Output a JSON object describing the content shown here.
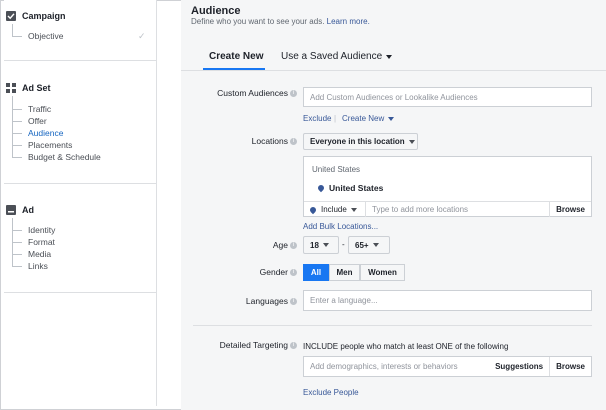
{
  "sidebar": {
    "campaign": {
      "title": "Campaign",
      "items": [
        "Objective"
      ],
      "done_mark": "✓"
    },
    "adset": {
      "title": "Ad Set",
      "items": [
        "Traffic",
        "Offer",
        "Audience",
        "Placements",
        "Budget & Schedule"
      ],
      "active": "Audience"
    },
    "ad": {
      "title": "Ad",
      "items": [
        "Identity",
        "Format",
        "Media",
        "Links"
      ]
    }
  },
  "main": {
    "title": "Audience",
    "subtitle": "Define who you want to see your ads.",
    "learn_more": "Learn more.",
    "tabs": [
      "Create New",
      "Use a Saved Audience"
    ],
    "custom_audiences": {
      "label": "Custom Audiences",
      "placeholder": "Add Custom Audiences or Lookalike Audiences",
      "exclude": "Exclude",
      "create_new": "Create New"
    },
    "locations": {
      "label": "Locations",
      "scope": "Everyone in this location",
      "country_header": "United States",
      "selected": "United States",
      "include": "Include",
      "type_placeholder": "Type to add more locations",
      "browse": "Browse",
      "bulk": "Add Bulk Locations..."
    },
    "age": {
      "label": "Age",
      "min": "18",
      "dash": "-",
      "max": "65+"
    },
    "gender": {
      "label": "Gender",
      "options": [
        "All",
        "Men",
        "Women"
      ],
      "selected": "All"
    },
    "languages": {
      "label": "Languages",
      "placeholder": "Enter a language..."
    },
    "detailed_targeting": {
      "label": "Detailed Targeting",
      "include_text": "INCLUDE people who match at least ONE of the following",
      "placeholder": "Add demographics, interests or behaviors",
      "suggestions": "Suggestions",
      "browse": "Browse",
      "exclude_people": "Exclude People"
    }
  },
  "colors": {
    "accent": "#1877f2",
    "link": "#385898",
    "panel_bg": "#f5f6f7"
  }
}
